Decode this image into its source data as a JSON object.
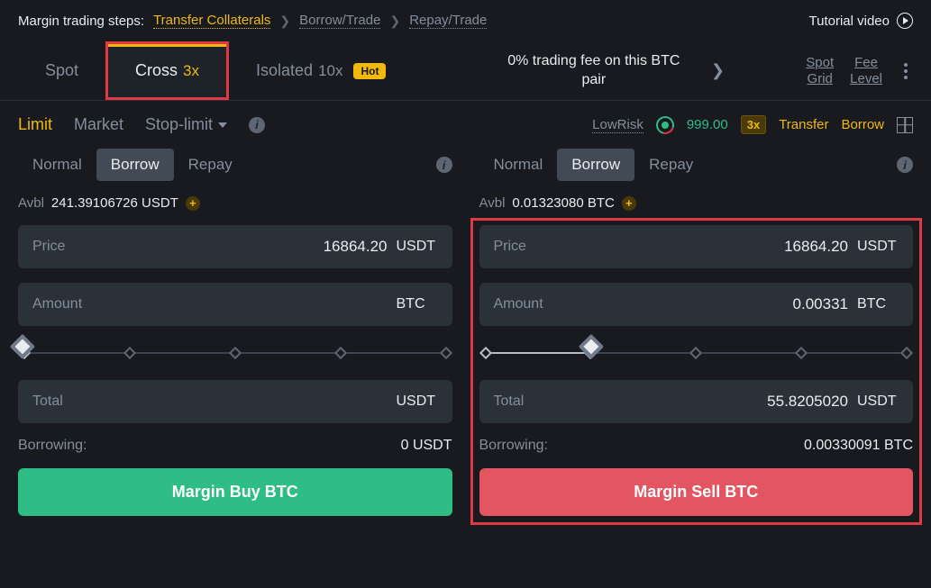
{
  "topbar": {
    "steps_label": "Margin trading steps:",
    "step1": "Transfer Collaterals",
    "step2": "Borrow/Trade",
    "step3": "Repay/Trade",
    "tutorial": "Tutorial video"
  },
  "mainTabs": {
    "spot": "Spot",
    "cross": "Cross",
    "cross_mult": "3x",
    "isolated": "Isolated",
    "isolated_mult": "10x",
    "hot": "Hot",
    "promo": "0% trading fee on this BTC pair",
    "spot_grid": "Spot Grid",
    "fee_level": "Fee Level"
  },
  "orderTypes": {
    "limit": "Limit",
    "market": "Market",
    "stoplimit": "Stop-limit",
    "risk_label": "LowRisk",
    "risk_value": "999.00",
    "leverage_badge": "3x",
    "transfer": "Transfer",
    "borrow": "Borrow"
  },
  "modes": {
    "normal": "Normal",
    "borrow": "Borrow",
    "repay": "Repay"
  },
  "buy": {
    "avbl_label": "Avbl",
    "avbl_value": "241.39106726 USDT",
    "price_label": "Price",
    "price_value": "16864.20",
    "price_unit": "USDT",
    "amount_label": "Amount",
    "amount_value": "",
    "amount_unit": "BTC",
    "total_label": "Total",
    "total_value": "",
    "total_unit": "USDT",
    "borrowing_label": "Borrowing:",
    "borrowing_value": "0 USDT",
    "button": "Margin Buy BTC",
    "slider_percent": 0
  },
  "sell": {
    "avbl_label": "Avbl",
    "avbl_value": "0.01323080 BTC",
    "price_label": "Price",
    "price_value": "16864.20",
    "price_unit": "USDT",
    "amount_label": "Amount",
    "amount_value": "0.00331",
    "amount_unit": "BTC",
    "total_label": "Total",
    "total_value": "55.8205020",
    "total_unit": "USDT",
    "borrowing_label": "Borrowing:",
    "borrowing_value": "0.00330091 BTC",
    "button": "Margin Sell BTC",
    "slider_percent": 25
  }
}
